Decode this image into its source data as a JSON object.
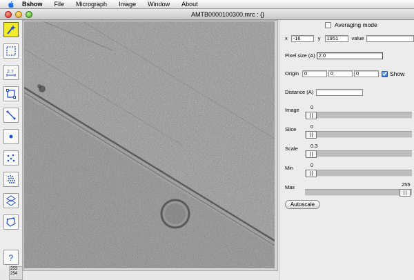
{
  "menubar": {
    "icon": "apple-icon",
    "items": [
      "Bshow",
      "File",
      "Micrograph",
      "Image",
      "Window",
      "About"
    ]
  },
  "window": {
    "title": "AMTB0000100300.mrc : {}"
  },
  "toolbar": {
    "tools": [
      {
        "icon": "wand-icon",
        "active": true
      },
      {
        "icon": "box-select-icon",
        "active": false
      },
      {
        "icon": "measure-icon",
        "active": false
      },
      {
        "icon": "crop-icon",
        "active": false
      },
      {
        "icon": "line-icon",
        "active": false
      },
      {
        "icon": "point-icon",
        "active": false
      },
      {
        "icon": "multi-point-icon",
        "active": false
      },
      {
        "icon": "grid-points-icon",
        "active": false
      },
      {
        "icon": "lattice-icon",
        "active": false
      },
      {
        "icon": "polygon-icon",
        "active": false
      },
      {
        "icon": "help-icon",
        "active": false
      }
    ],
    "tool_labels": {
      "measure": "2.7"
    },
    "help_label": "?"
  },
  "scroll": {
    "line1": "253",
    "line2": "254"
  },
  "panel": {
    "averaging_label": "Averaging mode",
    "averaging_checked": false,
    "x_label": "x",
    "x_value": "-16",
    "y_label": "y",
    "y_value": "1951",
    "value_label": "value",
    "value_value": "",
    "pixel_size_label": "Pixel size (A)",
    "pixel_size_value": "2.0",
    "origin_label": "Origin",
    "origin_values": [
      "0",
      "0",
      "0"
    ],
    "show_label": "Show",
    "show_checked": true,
    "distance_label": "Distance (A)",
    "distance_value": "",
    "sliders": {
      "image": {
        "label": "Image",
        "value": "0",
        "fraction": 0.0
      },
      "slice": {
        "label": "Slice",
        "value": "0",
        "fraction": 0.0
      },
      "scale": {
        "label": "Scale",
        "value": "0.3",
        "fraction": 0.0
      },
      "min": {
        "label": "Min",
        "value": "0",
        "fraction": 0.0
      },
      "max": {
        "label": "Max",
        "value": "255",
        "fraction": 1.0
      }
    },
    "autoscale_label": "Autoscale"
  },
  "colors": {
    "active_tool": "#f2ec2a",
    "tool_icon": "#1f4fcf",
    "checkbox_checked": "#2f6fd8"
  }
}
